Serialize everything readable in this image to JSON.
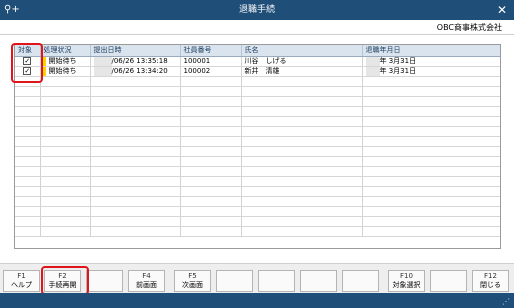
{
  "window": {
    "title": "退職手続",
    "app_icon": "search-plus-icon",
    "app_icon_glyph": "⚲+",
    "close_glyph": "✕"
  },
  "company": {
    "name": "OBC商事株式会社"
  },
  "grid": {
    "columns": [
      "対象",
      "処理状況",
      "提出日時",
      "社員番号",
      "氏名",
      "退職年月日"
    ],
    "rows": [
      {
        "checked": true,
        "check_glyph": "✓",
        "status": "開始待ち",
        "submitted": "/06/26 13:35:18",
        "employee_no": "100001",
        "name": "川谷　しげる",
        "retire_date": "年  3月31日"
      },
      {
        "checked": true,
        "check_glyph": "✓",
        "status": "開始待ち",
        "submitted": "/06/26 13:34:20",
        "employee_no": "100002",
        "name": "新井　清雄",
        "retire_date": "年  3月31日"
      }
    ],
    "status_color": "#ffd200",
    "highlight_color": "#e0141b"
  },
  "fkeys": [
    {
      "num": "F1",
      "label": "ヘルプ"
    },
    {
      "num": "F2",
      "label": "手続再開"
    },
    {
      "num": "",
      "label": ""
    },
    {
      "num": "F4",
      "label": "前画面"
    },
    {
      "num": "F5",
      "label": "次画面"
    },
    {
      "num": "",
      "label": ""
    },
    {
      "num": "",
      "label": ""
    },
    {
      "num": "",
      "label": ""
    },
    {
      "num": "",
      "label": ""
    },
    {
      "num": "F10",
      "label": "対象選択"
    },
    {
      "num": "",
      "label": ""
    },
    {
      "num": "F12",
      "label": "閉じる"
    }
  ],
  "colors": {
    "titlebar": "#1f4e79",
    "header": "#d9e4ef"
  }
}
